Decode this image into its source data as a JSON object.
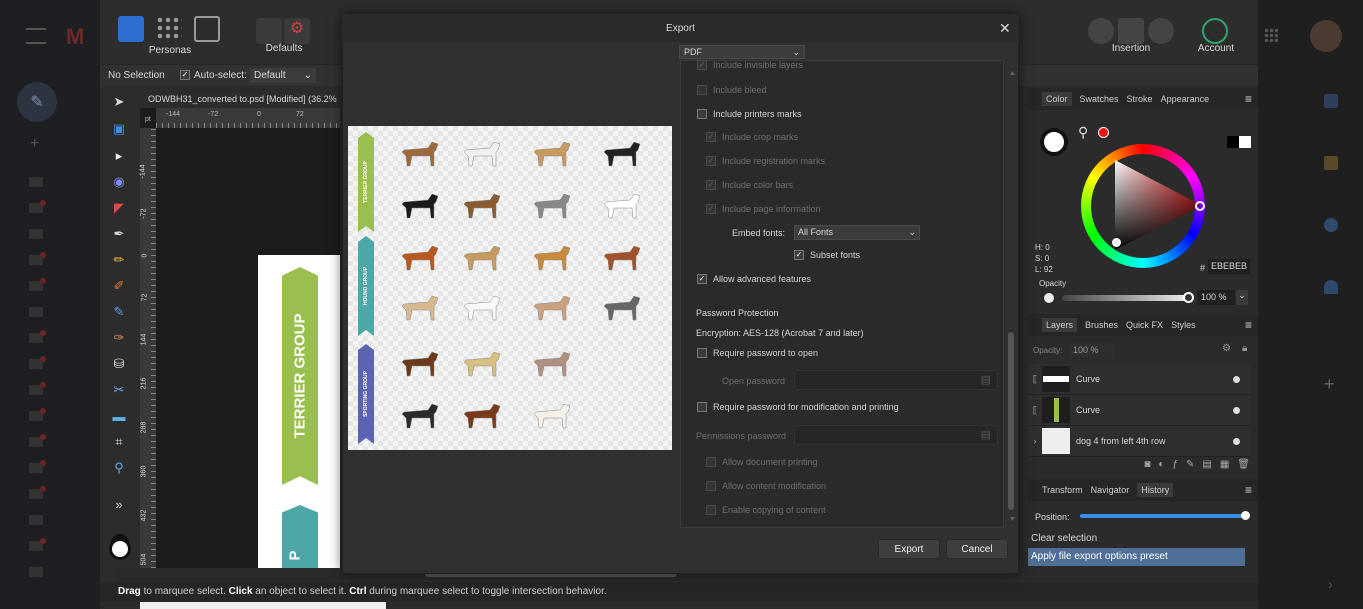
{
  "app": {
    "personas_label": "Personas",
    "defaults_label": "Defaults",
    "insertion_label": "Insertion",
    "account_label": "Account"
  },
  "context_bar": {
    "selection": "No Selection",
    "auto_select_label": "Auto-select:",
    "auto_select_value": "Default"
  },
  "document": {
    "tab_title": "ODWBH31_converted to.psd [Modified] (36.2%",
    "ruler_units": "pt",
    "ruler_top": [
      "-144",
      "-72",
      "0",
      "72"
    ],
    "ruler_left": [
      "-144",
      "-72",
      "0",
      "72",
      "144",
      "216",
      "288",
      "360",
      "432",
      "504"
    ],
    "canvas_text_1": "TERRIER GROUP",
    "canvas_text_2": "P"
  },
  "status_bar": {
    "t1": "Drag",
    "t2": " to marquee select. ",
    "t3": "Click",
    "t4": " an object to select it. ",
    "t5": "Ctrl",
    "t6": " during marquee select to toggle intersection behavior."
  },
  "dialog": {
    "title": "Export",
    "format": "PDF",
    "preview_bands": [
      "TERRIER GROUP",
      "HOUND GROUP",
      "SPORTING GROUP"
    ],
    "options": {
      "include_invisible": "Include invisible layers",
      "include_bleed": "Include bleed",
      "include_printers_marks": "Include printers marks",
      "include_crop_marks": "Include crop marks",
      "include_registration_marks": "Include registration marks",
      "include_color_bars": "Include color bars",
      "include_page_info": "Include page information",
      "embed_fonts_label": "Embed fonts:",
      "embed_fonts_value": "All Fonts",
      "subset_fonts": "Subset fonts",
      "allow_advanced": "Allow advanced features"
    },
    "password": {
      "heading": "Password Protection",
      "encryption": "Encryption: AES-128 (Acrobat 7 and later)",
      "require_open": "Require password to open",
      "open_password_label": "Open password",
      "require_modification": "Require password for modification and printing",
      "permissions_label": "Permissions password",
      "allow_printing": "Allow document printing",
      "allow_modification": "Allow content modification",
      "enable_copying": "Enable copying of content"
    },
    "export_button": "Export",
    "cancel_button": "Cancel"
  },
  "color_panel": {
    "tabs": [
      "Color",
      "Swatches",
      "Stroke",
      "Appearance"
    ],
    "h": "H: 0",
    "s": "S: 0",
    "l": "L: 92",
    "hex_label": "#",
    "hex_value": "EBEBEB",
    "opacity_label": "Opacity",
    "opacity_value": "100 %"
  },
  "layers_panel": {
    "tabs": [
      "Layers",
      "Brushes",
      "Quick FX",
      "Styles"
    ],
    "opacity_label": "Opacity:",
    "opacity_value": "100 %",
    "layers": [
      "Curve",
      "Curve",
      "dog 4 from left 4th row"
    ]
  },
  "history_panel": {
    "tabs": [
      "Transform",
      "Navigator",
      "History"
    ],
    "position_label": "Position:",
    "items": [
      "Clear selection",
      "Apply file export options preset"
    ]
  },
  "colors": {
    "accent": "#3a8ee6",
    "terrier": "#9bbf4e",
    "hound": "#4ea6a6",
    "sporting": "#5b64b0",
    "history_selected": "#4f6f96"
  }
}
